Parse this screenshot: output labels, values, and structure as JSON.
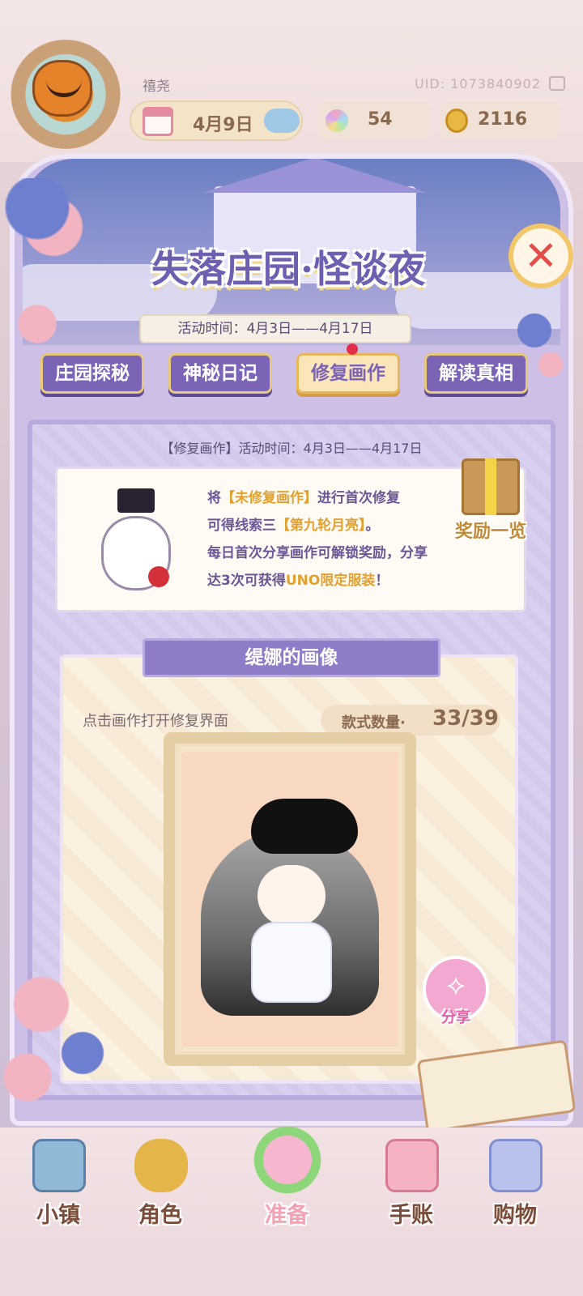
{
  "header": {
    "player_name": "禧尧",
    "uid": "UID: 1073840902",
    "date": "4月9日",
    "gems": "54",
    "coins": "2116",
    "icons": {
      "calendar": "calendar-icon",
      "weather": "cloud-icon",
      "gem": "flower-gem-icon",
      "coin": "coin-icon",
      "copy": "copy-icon"
    }
  },
  "event": {
    "title": "失落庄园·怪谈夜",
    "time": "活动时间：4月3日——4月17日"
  },
  "tabs": [
    {
      "label": "庄园探秘"
    },
    {
      "label": "神秘日记"
    },
    {
      "label": "修复画作"
    },
    {
      "label": "解读真相"
    }
  ],
  "panel": {
    "time": "【修复画作】活动时间：4月3日——4月17日",
    "info": {
      "line1_a": "将",
      "line1_hl": "【未修复画作】",
      "line1_b": "进行首次修复",
      "line2_a": "可得线索三",
      "line2_hl": "【第九轮月亮】",
      "line2_b": "。",
      "line3": "每日首次分享画作可解锁奖励，分享",
      "line4_a": "达3次可获得",
      "line4_hl": "UNO限定服装",
      "line4_b": "！"
    },
    "reward_label": "奖励一览",
    "painting": {
      "title": "缇娜的画像",
      "hint": "点击画作打开修复界面",
      "count_label": "款式数量·",
      "count_value": "33/39",
      "share_label": "分享"
    }
  },
  "nav": [
    {
      "label": "小镇"
    },
    {
      "label": "角色"
    },
    {
      "label": "准备"
    },
    {
      "label": "手账"
    },
    {
      "label": "购物"
    }
  ],
  "colors": {
    "accent_purple": "#7b64b6",
    "highlight": "#e0a12e",
    "close_red": "#e34d4a"
  }
}
